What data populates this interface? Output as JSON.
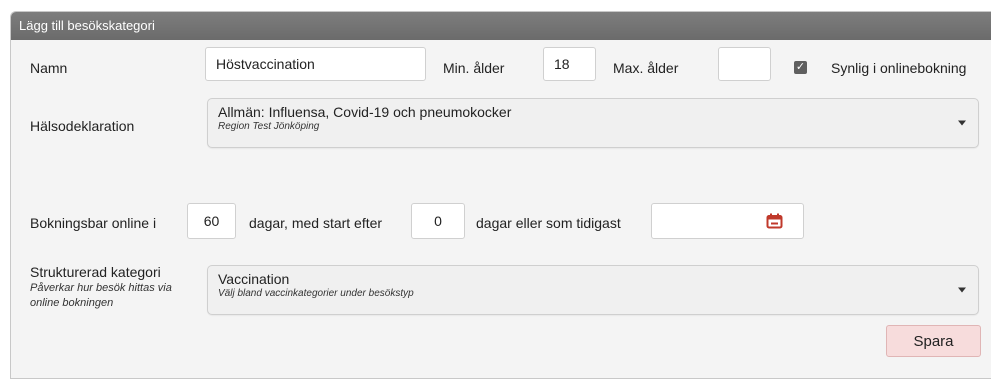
{
  "dialog": {
    "title": "Lägg till besökskategori"
  },
  "form": {
    "name_label": "Namn",
    "name_value": "Höstvaccination",
    "min_age_label": "Min. ålder",
    "min_age_value": "18",
    "max_age_label": "Max. ålder",
    "max_age_value": "",
    "online_visible_label": "Synlig i onlinebokning",
    "online_visible_checked": true,
    "health_declaration_label": "Hälsodeklaration",
    "health_declaration_value": "Allmän: Influensa, Covid-19 och pneumokocker",
    "health_declaration_sub": "Region Test Jönköping",
    "bookable_online_label": "Bokningsbar online i",
    "bookable_days_value": "60",
    "days_start_after_label": "dagar, med start efter",
    "start_after_value": "0",
    "days_or_earliest_label": "dagar eller som tidigast",
    "earliest_date_value": "",
    "structured_category_label": "Strukturerad kategori",
    "structured_category_help": "Påverkar hur besök hittas via online bokningen",
    "structured_category_value": "Vaccination",
    "structured_category_sub": "Välj bland vaccinkategorier under besökstyp",
    "save_label": "Spara"
  },
  "colors": {
    "header_bg": "#737373",
    "panel_bg": "#f4f4f4",
    "calendar_icon": "#c0392b",
    "save_button_bg": "#f7dcdc"
  },
  "icons": {
    "date_picker": "calendar-icon",
    "dropdown": "caret-down-icon",
    "checkbox": "check-icon"
  }
}
